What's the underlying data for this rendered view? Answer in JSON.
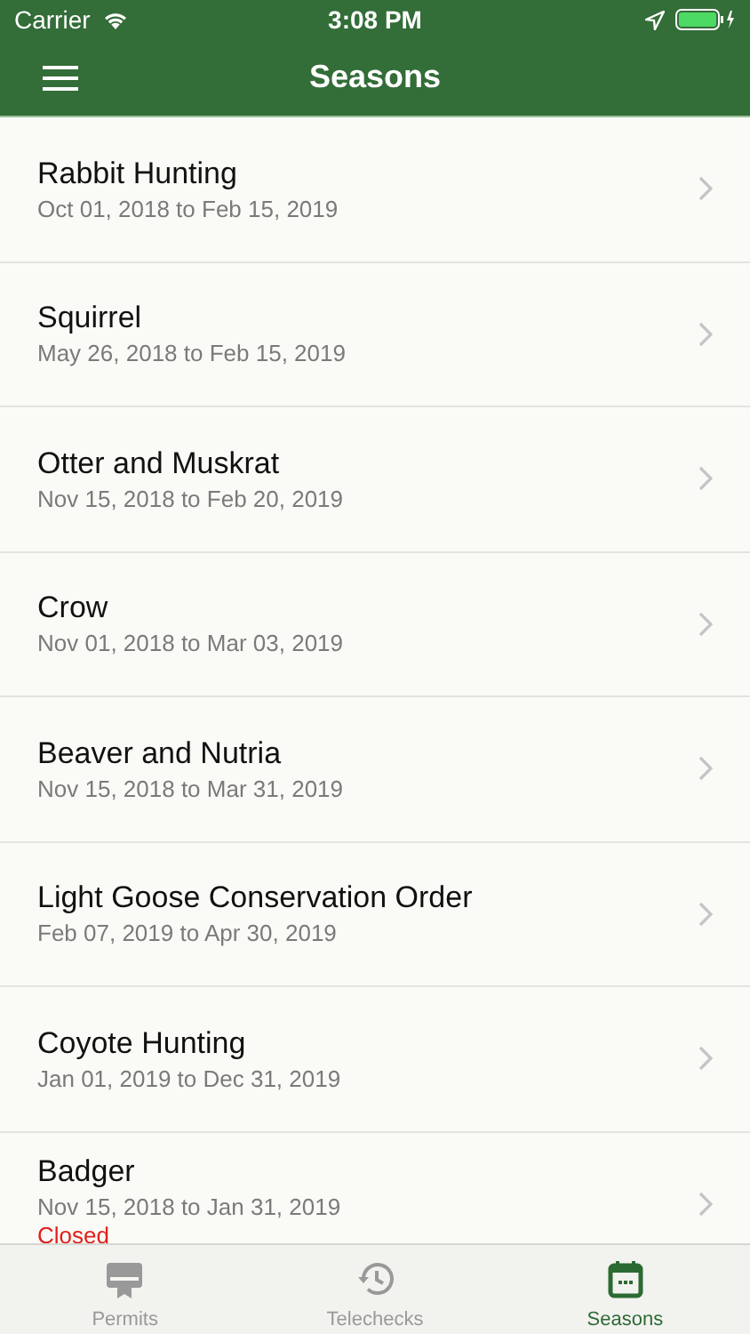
{
  "status_bar": {
    "carrier": "Carrier",
    "time": "3:08 PM"
  },
  "nav": {
    "title": "Seasons"
  },
  "seasons": [
    {
      "name": "Rabbit Hunting",
      "dates": "Oct 01, 2018 to Feb 15, 2019"
    },
    {
      "name": "Squirrel",
      "dates": "May 26, 2018 to Feb 15, 2019"
    },
    {
      "name": "Otter and Muskrat",
      "dates": "Nov 15, 2018 to Feb 20, 2019"
    },
    {
      "name": "Crow",
      "dates": "Nov 01, 2018 to Mar 03, 2019"
    },
    {
      "name": "Beaver and Nutria",
      "dates": "Nov 15, 2018 to Mar 31, 2019"
    },
    {
      "name": "Light Goose Conservation Order",
      "dates": "Feb 07, 2019 to Apr 30, 2019"
    },
    {
      "name": "Coyote Hunting",
      "dates": "Jan 01, 2019 to Dec 31, 2019"
    },
    {
      "name": "Badger",
      "dates": "Nov 15, 2018 to Jan 31, 2019",
      "status": "Closed"
    }
  ],
  "tabs": [
    {
      "label": "Permits",
      "kind": "permit",
      "selected": false
    },
    {
      "label": "Telechecks",
      "kind": "history",
      "selected": false
    },
    {
      "label": "Seasons",
      "kind": "calendar",
      "selected": true
    }
  ]
}
